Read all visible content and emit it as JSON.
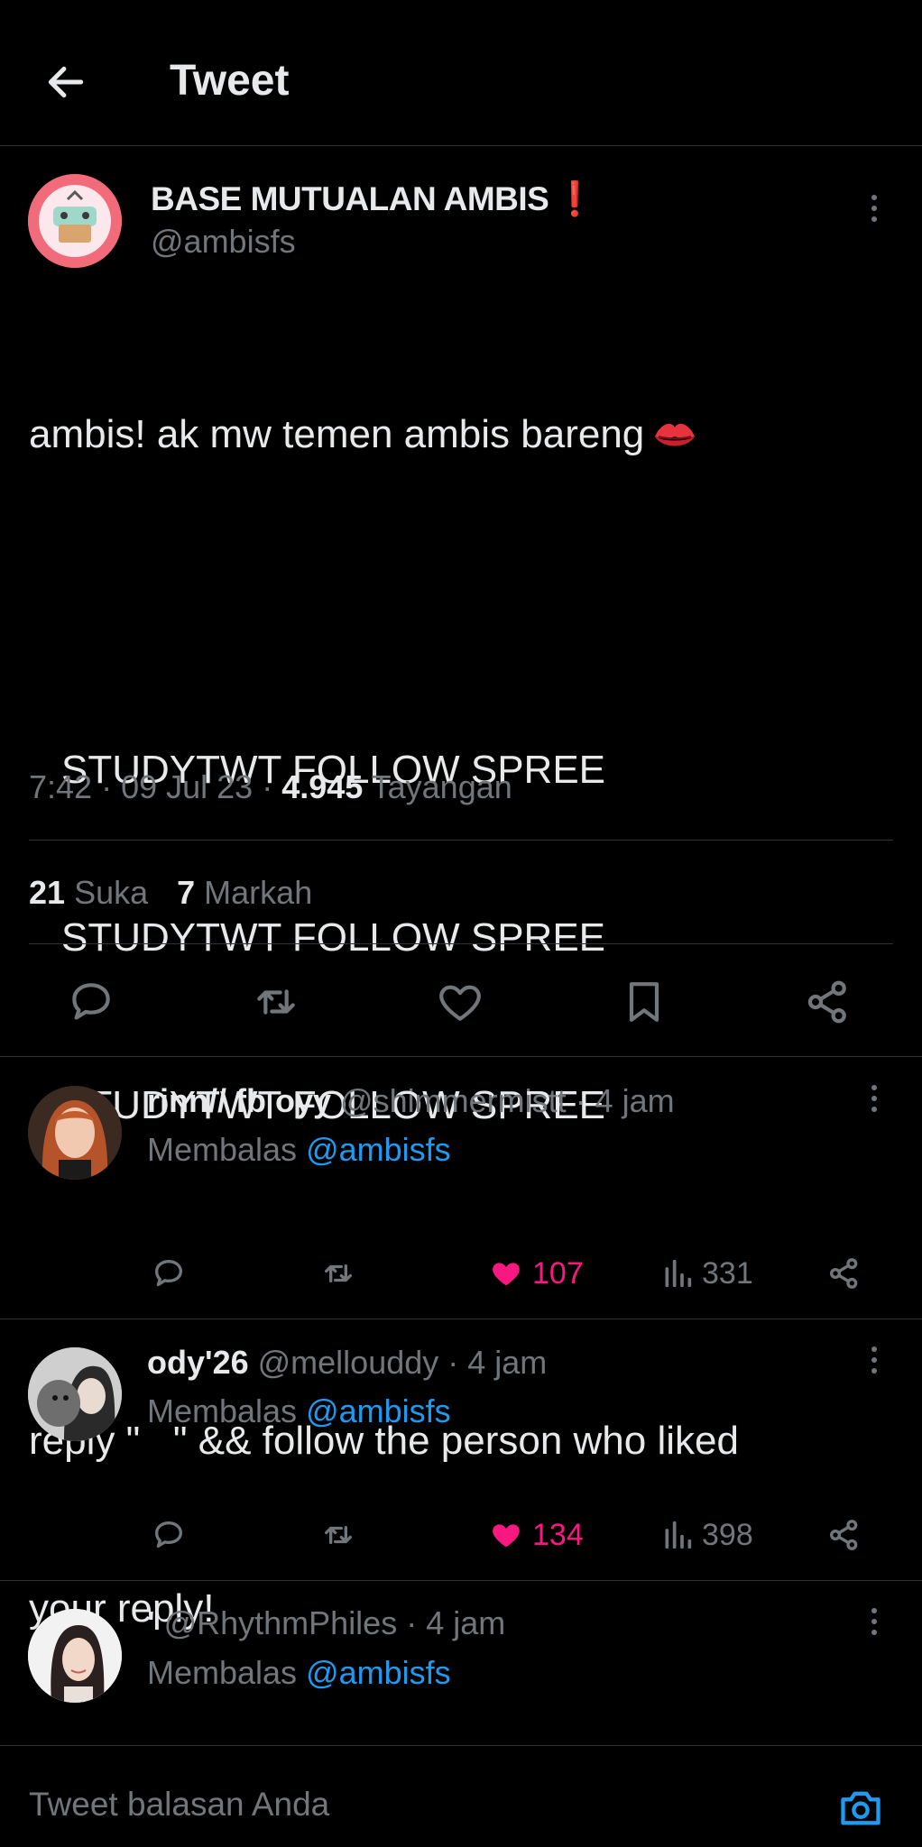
{
  "header": {
    "title": "Tweet"
  },
  "tweet": {
    "author_name": "BASE MUTUALAN AMBIS",
    "author_mark": "❗",
    "author_handle": "@ambisfs",
    "line1": "ambis! ak mw temen ambis bareng",
    "spree_lines": [
      "STUDYTWT FOLLOW SPREE",
      "STUDYTWT FOLLOW SPREE",
      "STUDYTWT FOLLOW SPREE"
    ],
    "line_reply": "reply \"   \" && follow the person who liked",
    "line_reply2": "your reply!",
    "time": "7:42",
    "date": "09 Jul 23",
    "views_count": "4.945",
    "views_label": "Tayangan",
    "likes_count": "21",
    "likes_label": "Suka",
    "bookmarks_count": "7",
    "bookmarks_label": "Markah"
  },
  "replies": [
    {
      "name": "rinn// fb oyy",
      "handle": "@shimmermistt",
      "time": "4 jam",
      "replying_prefix": "Membalas",
      "replying_to": "@ambisfs",
      "likes": "107",
      "views": "331"
    },
    {
      "name": "ody'26",
      "handle": "@mellouddy",
      "time": "4 jam",
      "replying_prefix": "Membalas",
      "replying_to": "@ambisfs",
      "likes": "134",
      "views": "398"
    },
    {
      "name": "'",
      "handle": "@RhythmPhiles",
      "time": "4 jam",
      "replying_prefix": "Membalas",
      "replying_to": "@ambisfs"
    }
  ],
  "composer": {
    "placeholder": "Tweet balasan Anda"
  },
  "colors": {
    "background": "#000000",
    "text": "#e7e9ea",
    "muted": "#71767b",
    "link": "#1d9bf0",
    "like": "#f91880",
    "divider": "#2f3336"
  },
  "icons": [
    "back-arrow-icon",
    "more-icon",
    "reply-icon",
    "retweet-icon",
    "like-icon",
    "bookmark-icon",
    "share-icon",
    "views-icon",
    "camera-icon",
    "kiss-emoji-icon"
  ]
}
